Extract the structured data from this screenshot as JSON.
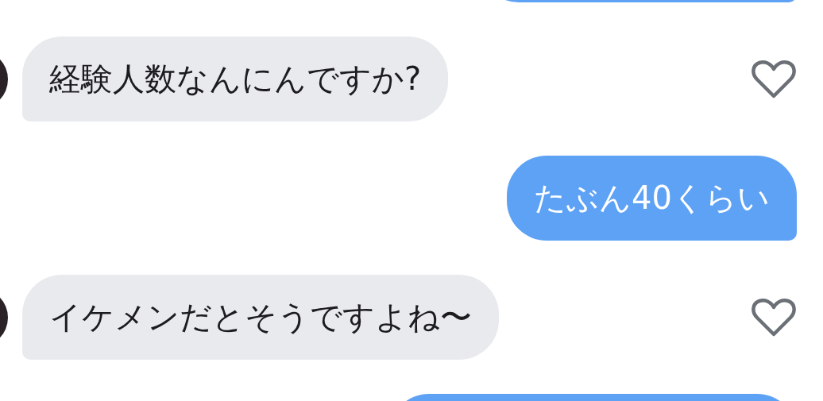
{
  "messages": [
    {
      "kind": "outgoing"
    },
    {
      "kind": "incoming",
      "text": "経験人数なんにんですか?",
      "liked": false
    },
    {
      "kind": "outgoing",
      "text": "たぶん40くらい"
    },
    {
      "kind": "incoming",
      "text": "イケメンだとそうですよね〜",
      "liked": false
    },
    {
      "kind": "outgoing"
    }
  ]
}
